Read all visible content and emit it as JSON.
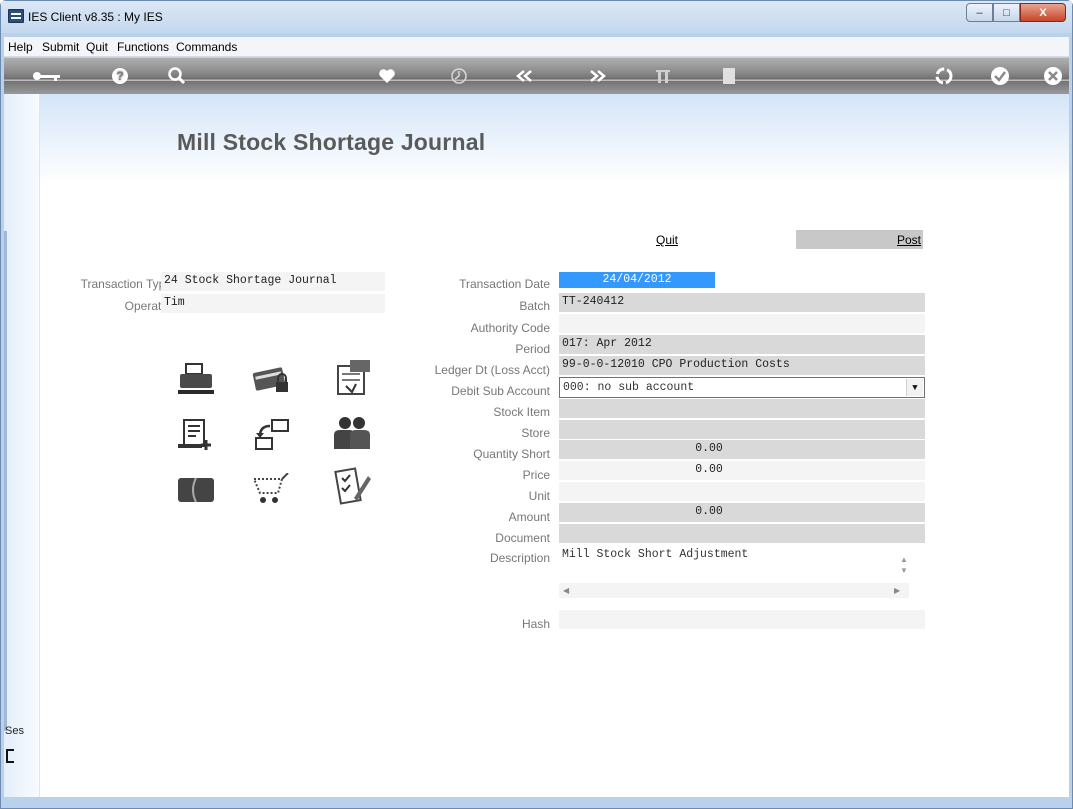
{
  "window": {
    "title": "IES Client v8.35 : My IES",
    "controls": {
      "minimize": "–",
      "maximize": "□",
      "close": "X"
    }
  },
  "menu": [
    "Help",
    "Submit",
    "Quit",
    "Functions",
    "Commands"
  ],
  "toolbar": {
    "icons": [
      "key-icon",
      "help-icon",
      "search-icon",
      "heart-icon",
      "clock-icon",
      "rewind-icon",
      "forward-icon",
      "tools-icon",
      "document-icon",
      "recycle-icon",
      "check-icon",
      "close-icon"
    ]
  },
  "page": {
    "title": "Mill Stock Shortage Journal"
  },
  "actions": {
    "quit": "Quit",
    "post": "Post"
  },
  "left_form": {
    "transaction_type_label": "Transaction Type",
    "transaction_type_value": "24 Stock Shortage Journal",
    "operator_label": "Operator",
    "operator_value": "Tim"
  },
  "form": {
    "transaction_date": {
      "label": "Transaction Date",
      "value": "24/04/2012"
    },
    "batch": {
      "label": "Batch",
      "value": "TT-240412"
    },
    "authority_code": {
      "label": "Authority Code",
      "value": ""
    },
    "period": {
      "label": "Period",
      "value": "017: Apr 2012"
    },
    "ledger_dt": {
      "label": "Ledger Dt (Loss Acct)",
      "value": "99-0-0-12010 CPO Production Costs"
    },
    "debit_sub_account": {
      "label": "Debit Sub Account",
      "value": "000: no sub account"
    },
    "stock_item": {
      "label": "Stock Item",
      "value": ""
    },
    "store": {
      "label": "Store",
      "value": ""
    },
    "quantity_short": {
      "label": "Quantity Short",
      "value": "0.00"
    },
    "price": {
      "label": "Price",
      "value": "0.00"
    },
    "unit": {
      "label": "Unit",
      "value": ""
    },
    "amount": {
      "label": "Amount",
      "value": "0.00"
    },
    "document": {
      "label": "Document",
      "value": ""
    },
    "description": {
      "label": "Description",
      "value": "Mill Stock Short Adjustment"
    },
    "hash": {
      "label": "Hash",
      "value": ""
    }
  },
  "shortcut_icons": [
    "printer-icon",
    "card-lock-icon",
    "certificate-icon",
    "receipt-add-icon",
    "transfer-icon",
    "users-icon",
    "credit-card-icon",
    "cart-icon",
    "checklist-icon"
  ],
  "session": {
    "label": "Ses"
  }
}
